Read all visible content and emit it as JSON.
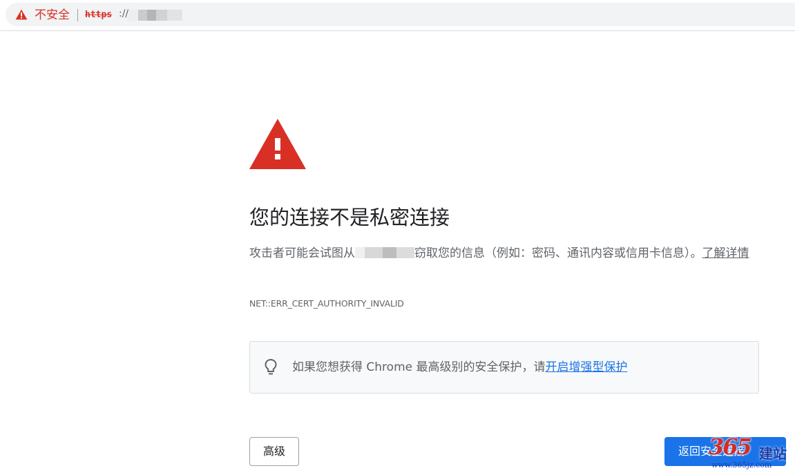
{
  "address_bar": {
    "security_label": "不安全",
    "scheme": "https",
    "separator": "://"
  },
  "interstitial": {
    "icon": "warning-triangle-icon",
    "title": "您的连接不是私密连接",
    "desc_before": "攻击者可能会试图从",
    "desc_after": "窃取您的信息（例如：密码、通讯内容或信用卡信息）。",
    "learn_more": "了解详情",
    "error_code": "NET::ERR_CERT_AUTHORITY_INVALID",
    "tip": {
      "icon": "lightbulb-icon",
      "text": "如果您想获得 Chrome 最高级别的安全保护，请",
      "link": "开启增强型保护"
    },
    "advanced_button": "高级",
    "back_button": "返回安全连接"
  },
  "watermark": {
    "logo": "365",
    "name": "建站",
    "url": "www.365jz.com"
  },
  "colors": {
    "danger": "#d93025",
    "primary": "#1a73e8",
    "text_secondary": "#5f6368"
  }
}
